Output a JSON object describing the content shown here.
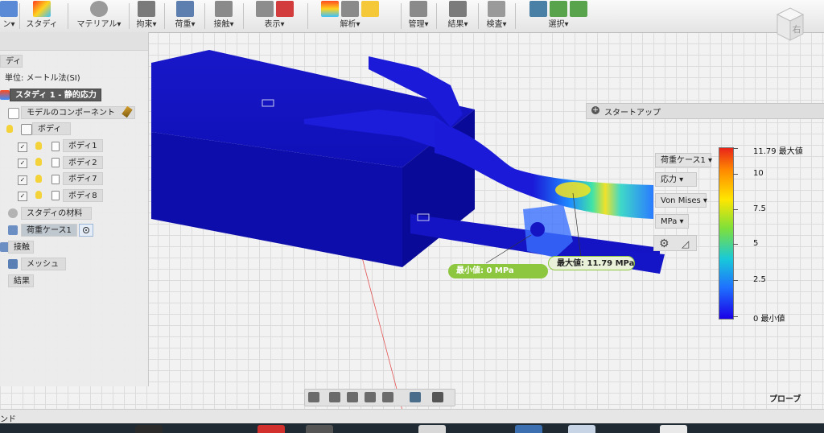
{
  "toolbar": {
    "groups": [
      {
        "label": "ン▾"
      },
      {
        "label": "スタディ"
      },
      {
        "label": "マテリアル▾"
      },
      {
        "label": "拘束▾"
      },
      {
        "label": "荷重▾"
      },
      {
        "label": "接触▾"
      },
      {
        "label": "表示▾"
      },
      {
        "label": "解析▾"
      },
      {
        "label": "管理▾"
      },
      {
        "label": "結果▾"
      },
      {
        "label": "検査▾"
      },
      {
        "label": "選択▾"
      }
    ]
  },
  "browser": {
    "header": "ディ",
    "units": "単位: メートル法(SI)",
    "study": "スタディ 1 - 静的応力",
    "components": "モデルのコンポーネント",
    "bodies_folder": "ボディ",
    "bodies": [
      "ボディ1",
      "ボディ2",
      "ボディ7",
      "ボディ8"
    ],
    "materials": "スタディの材料",
    "loadcase": "荷重ケース1",
    "contacts": "接触",
    "mesh": "メッシュ",
    "results": "結果"
  },
  "startup": {
    "label": "スタートアップ"
  },
  "legend": {
    "loadcase_dd": "荷重ケース1 ▾",
    "type_dd": "応力 ▾",
    "criterion_dd": "Von Mises ▾",
    "unit_dd": "MPa ▾",
    "ticks": [
      "11.79 最大値",
      "10",
      "7.5",
      "5",
      "2.5",
      "0 最小値"
    ]
  },
  "labels": {
    "min": "最小値: 0 MPa",
    "max": "最大値: 11.79 MPa"
  },
  "viewcube": {
    "face": "右"
  },
  "probe": "プローブ",
  "status": "ンド",
  "colors": {
    "accent": "#8dc63f",
    "body": "#1c1cd6",
    "toolbar_bg": "#eeeeee"
  }
}
